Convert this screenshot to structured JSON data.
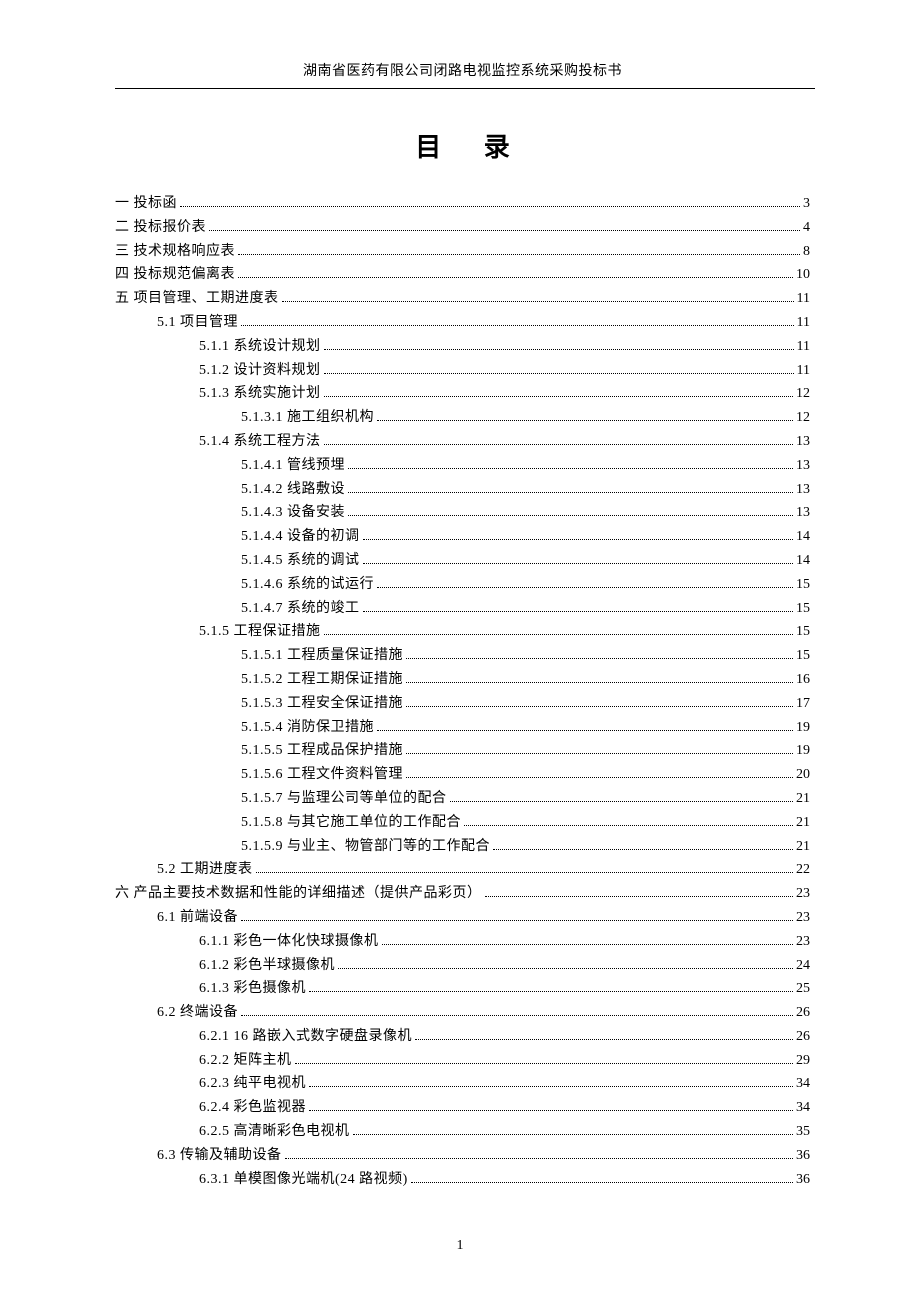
{
  "header": "湖南省医药有限公司闭路电视监控系统采购投标书",
  "title": "目 录",
  "page_number": "1",
  "toc": [
    {
      "level": 0,
      "label": "一  投标函",
      "page": "3"
    },
    {
      "level": 0,
      "label": "二  投标报价表",
      "page": "4"
    },
    {
      "level": 0,
      "label": "三  技术规格响应表",
      "page": "8"
    },
    {
      "level": 0,
      "label": "四  投标规范偏离表",
      "page": "10"
    },
    {
      "level": 0,
      "label": "五  项目管理、工期进度表",
      "page": "11"
    },
    {
      "level": 1,
      "label": "5.1  项目管理",
      "page": "11"
    },
    {
      "level": 2,
      "label": "5.1.1  系统设计规划",
      "page": "11"
    },
    {
      "level": 2,
      "label": "5.1.2  设计资料规划",
      "page": "11"
    },
    {
      "level": 2,
      "label": "5.1.3  系统实施计划",
      "page": "12"
    },
    {
      "level": 3,
      "label": "5.1.3.1  施工组织机构",
      "page": "12"
    },
    {
      "level": 2,
      "label": "5.1.4  系统工程方法",
      "page": "13"
    },
    {
      "level": 3,
      "label": "5.1.4.1  管线预埋",
      "page": "13"
    },
    {
      "level": 3,
      "label": "5.1.4.2  线路敷设",
      "page": "13"
    },
    {
      "level": 3,
      "label": "5.1.4.3  设备安装",
      "page": "13"
    },
    {
      "level": 3,
      "label": "5.1.4.4  设备的初调",
      "page": "14"
    },
    {
      "level": 3,
      "label": "5.1.4.5  系统的调试",
      "page": "14"
    },
    {
      "level": 3,
      "label": "5.1.4.6  系统的试运行",
      "page": "15"
    },
    {
      "level": 3,
      "label": "5.1.4.7  系统的竣工",
      "page": "15"
    },
    {
      "level": 2,
      "label": "5.1.5  工程保证措施",
      "page": "15"
    },
    {
      "level": 3,
      "label": "5.1.5.1  工程质量保证措施",
      "page": "15"
    },
    {
      "level": 3,
      "label": "5.1.5.2  工程工期保证措施",
      "page": "16"
    },
    {
      "level": 3,
      "label": "5.1.5.3  工程安全保证措施",
      "page": "17"
    },
    {
      "level": 3,
      "label": "5.1.5.4  消防保卫措施",
      "page": "19"
    },
    {
      "level": 3,
      "label": "5.1.5.5  工程成品保护措施",
      "page": "19"
    },
    {
      "level": 3,
      "label": "5.1.5.6  工程文件资料管理",
      "page": "20"
    },
    {
      "level": 3,
      "label": "5.1.5.7  与监理公司等单位的配合",
      "page": "21"
    },
    {
      "level": 3,
      "label": "5.1.5.8  与其它施工单位的工作配合",
      "page": "21"
    },
    {
      "level": 3,
      "label": "5.1.5.9  与业主、物管部门等的工作配合",
      "page": "21"
    },
    {
      "level": 1,
      "label": "5.2  工期进度表",
      "page": "22"
    },
    {
      "level": 0,
      "label": "六  产品主要技术数据和性能的详细描述（提供产品彩页）",
      "page": "23"
    },
    {
      "level": 1,
      "label": "6.1  前端设备",
      "page": "23"
    },
    {
      "level": 2,
      "label": "6.1.1  彩色一体化快球摄像机",
      "page": "23"
    },
    {
      "level": 2,
      "label": "6.1.2  彩色半球摄像机",
      "page": "24"
    },
    {
      "level": 2,
      "label": "6.1.3  彩色摄像机",
      "page": "25"
    },
    {
      "level": 1,
      "label": "6.2  终端设备",
      "page": "26"
    },
    {
      "level": 2,
      "label": "6.2.1 16 路嵌入式数字硬盘录像机",
      "page": "26"
    },
    {
      "level": 2,
      "label": "6.2.2  矩阵主机",
      "page": "29"
    },
    {
      "level": 2,
      "label": "6.2.3  纯平电视机",
      "page": "34"
    },
    {
      "level": 2,
      "label": "6.2.4  彩色监视器",
      "page": "34"
    },
    {
      "level": 2,
      "label": "6.2.5  高清晰彩色电视机",
      "page": "35"
    },
    {
      "level": 1,
      "label": "6.3  传输及辅助设备",
      "page": "36"
    },
    {
      "level": 2,
      "label": "6.3.1  单模图像光端机(24 路视频)",
      "page": "36"
    }
  ]
}
